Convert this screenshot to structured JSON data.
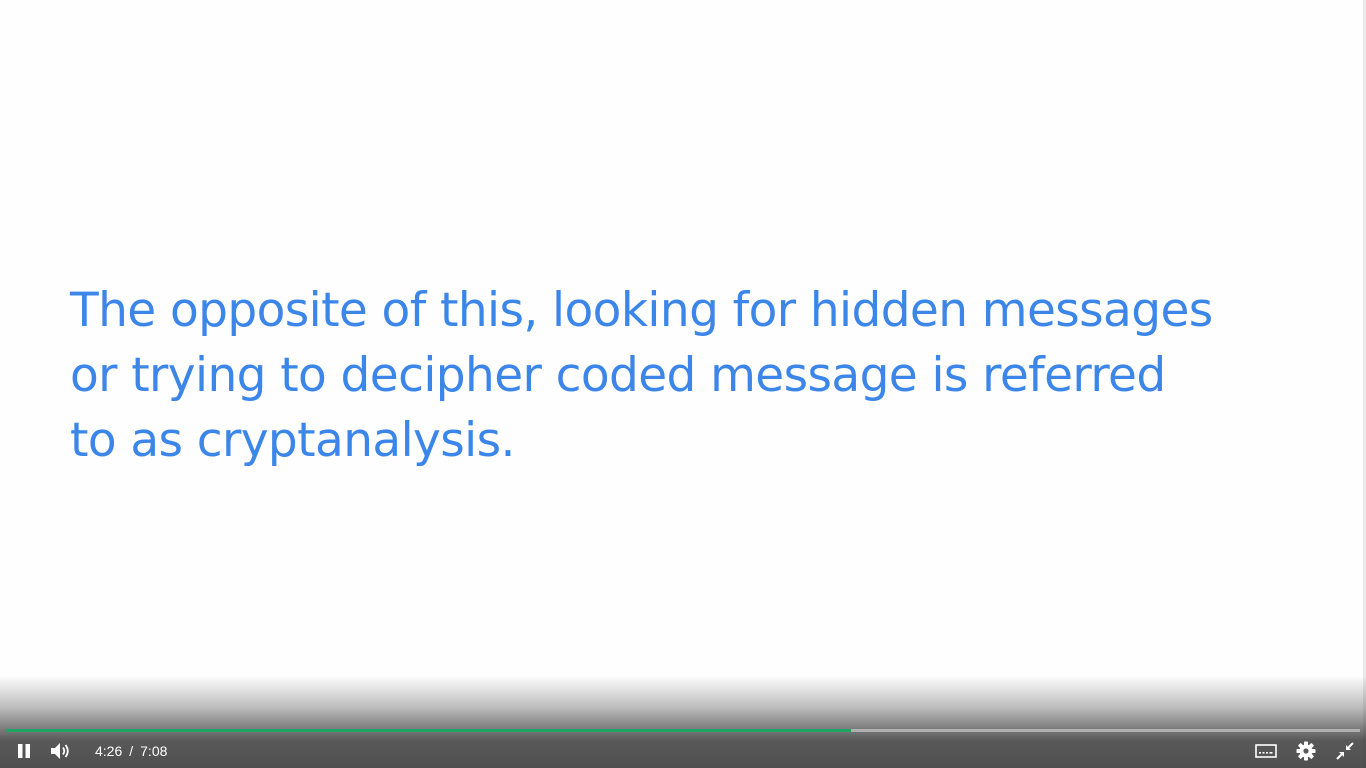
{
  "slide": {
    "lines": [
      "The opposite of this, looking for hidden messages",
      "or trying to decipher coded message is referred",
      "to as cryptanalysis."
    ],
    "text_color": "#3b86e8"
  },
  "player": {
    "state": "playing",
    "current_time": "4:26",
    "separator": "/",
    "duration": "7:08",
    "progress_fraction": 0.6239,
    "progress_color": "#1fa463",
    "icons": {
      "play_pause": "pause-icon",
      "volume": "volume-icon",
      "captions": "captions-icon",
      "settings": "gear-icon",
      "fullscreen": "exit-fullscreen-icon"
    }
  }
}
